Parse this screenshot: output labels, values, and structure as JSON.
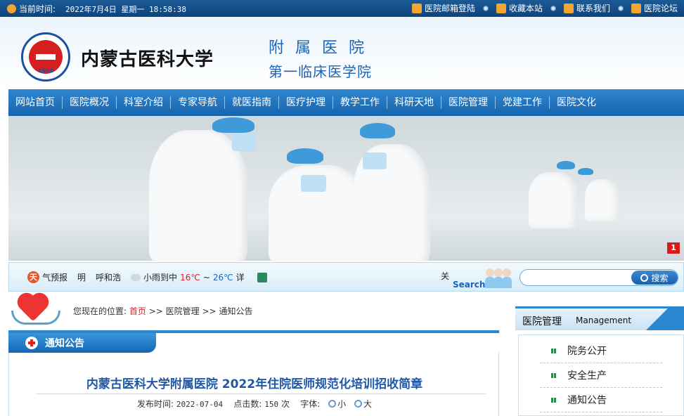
{
  "topbar": {
    "time_label": "当前时间:",
    "time_value": "2022年7月4日 星期一 18:58:38",
    "links": [
      "医院邮箱登陆",
      "收藏本站",
      "联系我们",
      "医院论坛"
    ]
  },
  "header": {
    "university": "内蒙古医科大学",
    "subtitle1": "附属医院",
    "subtitle2": "第一临床医学院",
    "logo_year": "1958"
  },
  "nav": {
    "items": [
      "网站首页",
      "医院概况",
      "科室介绍",
      "专家导航",
      "就医指南",
      "医疗护理",
      "教学工作",
      "科研天地",
      "医院管理",
      "党建工作",
      "医院文化"
    ]
  },
  "banner": {
    "slide": "1"
  },
  "weather": {
    "icon_char": "天",
    "label": "气预报",
    "day": "明",
    "city": "呼和浩",
    "condition": "小雨到中",
    "temp_low": "16℃",
    "tilde": "~",
    "temp_high": "26℃",
    "detail": "详"
  },
  "search": {
    "kw_label": "关",
    "search_label": "Search",
    "button": "搜索",
    "placeholder": ""
  },
  "breadcrumb": {
    "prefix": "您现在的位置:",
    "home": "首页",
    "sep": ">>",
    "level1": "医院管理",
    "level2": "通知公告"
  },
  "content": {
    "tab_title": "通知公告",
    "article_title": "内蒙古医科大学附属医院 2022年住院医师规范化培训招收简章",
    "date_label": "发布时间:",
    "date": "2022-07-04",
    "clicks_label": "点击数:",
    "clicks": "150",
    "clicks_unit": "次",
    "font_label": "字体:",
    "font_small": "小",
    "font_large": "大"
  },
  "sidebar": {
    "title_cn": "医院管理",
    "title_en": "Management",
    "items": [
      "院务公开",
      "安全生产",
      "通知公告"
    ]
  },
  "colors": {
    "topbar": "#0e447d",
    "nav": "#1763ad",
    "accent_red": "#d0232b",
    "title_blue": "#1f58a8"
  }
}
